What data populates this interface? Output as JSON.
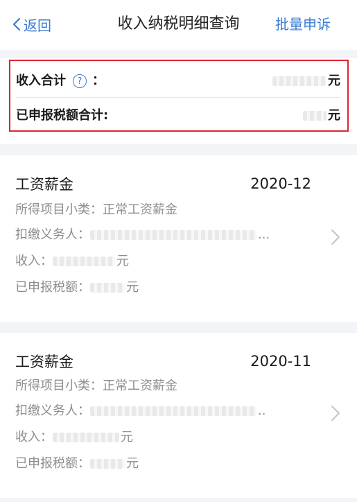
{
  "nav": {
    "back_label": "返回",
    "title": "收入纳税明细查询",
    "action_label": "批量申诉"
  },
  "summary": {
    "income_total_label": "收入合计",
    "colon": "：",
    "income_total_unit": "元",
    "tax_total_label": "已申报税额合计:",
    "tax_total_unit": "元"
  },
  "records": [
    {
      "category": "工资薪金",
      "period": "2020-12",
      "subtype_label": "所得项目小类：",
      "subtype_value": "正常工资薪金",
      "payer_label": "扣缴义务人：",
      "payer_suffix": "...",
      "income_label": "收入：",
      "income_unit": "元",
      "tax_label": "已申报税额：",
      "tax_unit": "元"
    },
    {
      "category": "工资薪金",
      "period": "2020-11",
      "subtype_label": "所得项目小类：",
      "subtype_value": "正常工资薪金",
      "payer_label": "扣缴义务人：",
      "payer_suffix": "..",
      "income_label": "收入：",
      "income_unit": "元",
      "tax_label": "已申报税额：",
      "tax_unit": "元"
    }
  ],
  "colors": {
    "accent": "#3a7bd5",
    "highlight_border": "#e0242f",
    "secondary_text": "#8d8d8d",
    "separator_bg": "#f2f4f8"
  },
  "icons": {
    "back": "chevron-left-icon",
    "help": "question-circle-icon",
    "row_arrow": "chevron-right-icon"
  }
}
